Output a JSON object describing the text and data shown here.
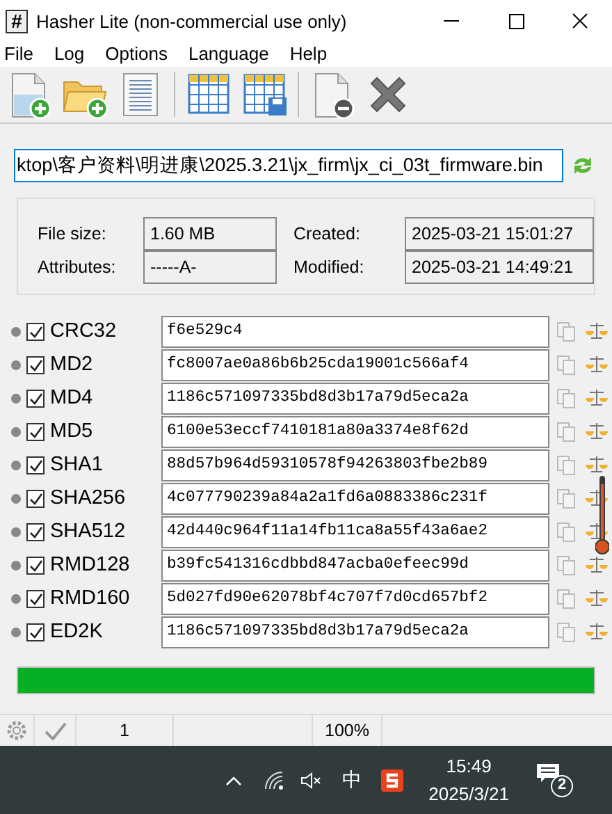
{
  "window": {
    "title": "Hasher Lite (non-commercial use only)",
    "icon_glyph": "#"
  },
  "menu": [
    "File",
    "Log",
    "Options",
    "Language",
    "Help"
  ],
  "path_field": {
    "value": "ktop\\客户资料\\明进康\\2025.3.21\\jx_firm\\jx_ci_03t_firmware.bin"
  },
  "file_info": [
    {
      "label": "File size:",
      "value": "1.60 MB"
    },
    {
      "label": "Created:",
      "value": "2025-03-21 15:01:27"
    },
    {
      "label": "Attributes:",
      "value": "-----A-"
    },
    {
      "label": "Modified:",
      "value": "2025-03-21 14:49:21"
    }
  ],
  "hashes": [
    {
      "name": "CRC32",
      "checked": true,
      "value": "f6e529c4"
    },
    {
      "name": "MD2",
      "checked": true,
      "value": "fc8007ae0a86b6b25cda19001c566af4"
    },
    {
      "name": "MD4",
      "checked": true,
      "value": "1186c571097335bd8d3b17a79d5eca2a"
    },
    {
      "name": "MD5",
      "checked": true,
      "value": "6100e53eccf7410181a80a3374e8f62d"
    },
    {
      "name": "SHA1",
      "checked": true,
      "value": "88d57b964d59310578f94263803fbe2b89"
    },
    {
      "name": "SHA256",
      "checked": true,
      "value": "4c077790239a84a2a1fd6a0883386c231f"
    },
    {
      "name": "SHA512",
      "checked": true,
      "value": "42d440c964f11a14fb11ca8a55f43a6ae2"
    },
    {
      "name": "RMD128",
      "checked": true,
      "value": "b39fc541316cdbbd847acba0efeec99d"
    },
    {
      "name": "RMD160",
      "checked": true,
      "value": "5d027fd90e62078bf4c707f7d0cd657bf2"
    },
    {
      "name": "ED2K",
      "checked": true,
      "value": "1186c571097335bd8d3b17a79d5eca2a"
    }
  ],
  "progress": {
    "level": 1
  },
  "status_bar": {
    "count": "1",
    "percent": "100%"
  },
  "taskbar": {
    "ime": "中",
    "time": "15:49",
    "date": "2025/3/21",
    "notifications": "2"
  }
}
